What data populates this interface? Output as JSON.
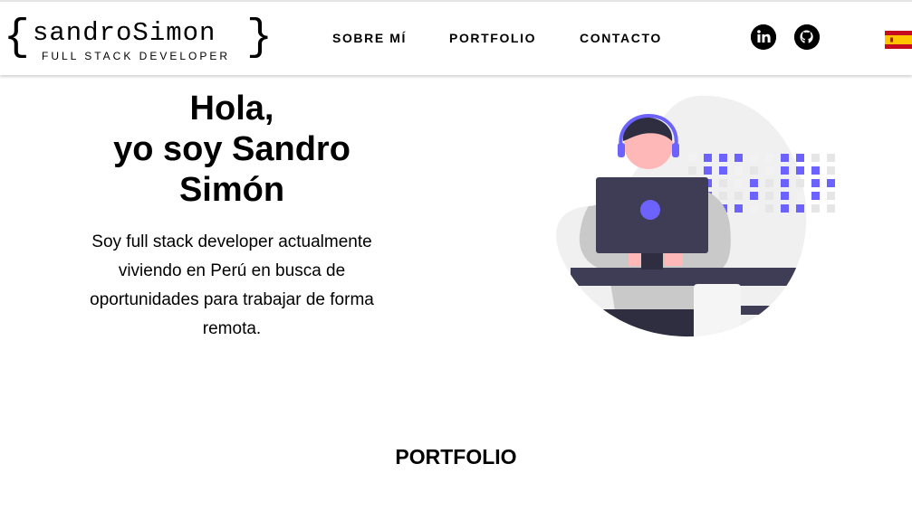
{
  "brand": {
    "name": "sandroSimon",
    "tagline": "FULL STACK DEVELOPER",
    "brace_open": "{",
    "brace_close": "}"
  },
  "nav": {
    "items": [
      {
        "label": "SOBRE MÍ"
      },
      {
        "label": "PORTFOLIO"
      },
      {
        "label": "CONTACTO"
      }
    ]
  },
  "social": [
    {
      "icon": "linkedin-icon",
      "label": "in"
    },
    {
      "icon": "github-icon"
    }
  ],
  "language": {
    "icon": "spain-flag-icon"
  },
  "hero": {
    "title_line1": "Hola,",
    "title_line2": "yo soy Sandro",
    "title_line3": "Simón",
    "description": "Soy full stack developer actualmente viviendo en Perú en busca de oportunidades para trabajar de forma remota."
  },
  "sections": {
    "portfolio_title": "PORTFOLIO"
  },
  "colors": {
    "accent": "#6c63ff",
    "dark": "#3f3d56",
    "text": "#000000",
    "light_gray": "#f0f0f0"
  }
}
